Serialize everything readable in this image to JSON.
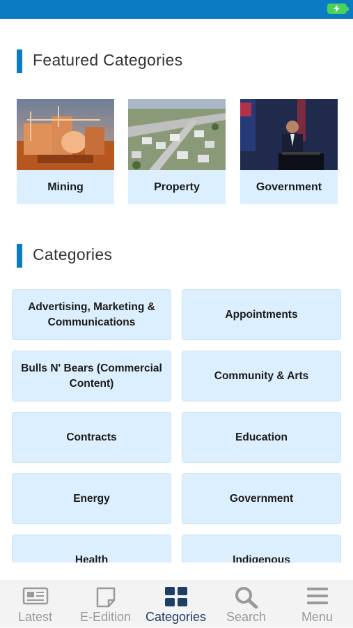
{
  "featured": {
    "title": "Featured Categories",
    "items": [
      {
        "label": "Mining"
      },
      {
        "label": "Property"
      },
      {
        "label": "Government"
      }
    ]
  },
  "categories": {
    "title": "Categories",
    "items": [
      {
        "label": "Advertising, Marketing & Communications"
      },
      {
        "label": "Appointments"
      },
      {
        "label": "Bulls N' Bears (Commercial Content)"
      },
      {
        "label": "Community & Arts"
      },
      {
        "label": "Contracts"
      },
      {
        "label": "Education"
      },
      {
        "label": "Energy"
      },
      {
        "label": "Government"
      },
      {
        "label": "Health"
      },
      {
        "label": "Indigenous"
      }
    ]
  },
  "tabbar": {
    "tabs": [
      {
        "label": "Latest",
        "icon": "newspaper-icon"
      },
      {
        "label": "E-Edition",
        "icon": "page-icon"
      },
      {
        "label": "Categories",
        "icon": "grid-icon",
        "active": true
      },
      {
        "label": "Search",
        "icon": "search-icon"
      },
      {
        "label": "Menu",
        "icon": "menu-icon"
      }
    ]
  },
  "colors": {
    "accent": "#0a7cc4",
    "tile_bg": "#dcefff",
    "active_tab": "#1c3f66",
    "inactive_tab": "#9a9a9a"
  }
}
